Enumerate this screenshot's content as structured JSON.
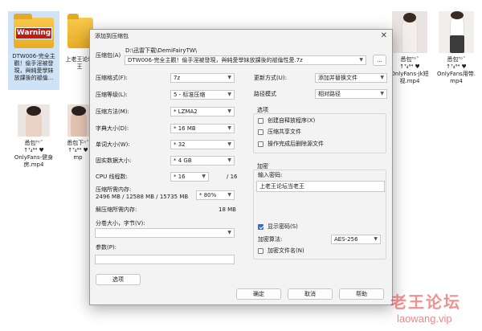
{
  "desktop": {
    "item1": {
      "badge": "Warning",
      "caption": "DTW006-完全主\n觀！偷手淫被發\n現，與純愛學妹\n放課後的褪倫..."
    },
    "item2": {
      "caption": "上老王论坛\n王"
    },
    "item3": {
      "caption": "悉包ᵀᵒ˜\n↑ᵀ₄⁶⁴ ♥\nOnlyFans-jk短\n视.mp4"
    },
    "item4": {
      "caption": "悉包ᵀᵒ˜\n↑ᵀ₄⁶⁴ ♥\nOnlyFans用带.\nmp4"
    },
    "item5": {
      "caption": "悉包ᵀᵒ˜\n↑ᵀ₄⁶⁴ ♥\nOnlyFans-健身\n房.mp4"
    },
    "item6": {
      "caption": "悉包下ᵒ˜\n↑ᵀ₄⁶⁴ ♥\nmp"
    }
  },
  "dialog": {
    "title": "添加到压缩包",
    "archive_label": "压缩包(A)",
    "archive_dir": "D:\\迅雷下载\\DemiFairyTW\\",
    "archive_name": "DTW006-完全主觀！偷手淫被發現，與純愛學妹放課後的褪倫性愛.7z",
    "browse_label": "...",
    "format_label": "压缩格式(F):",
    "format_value": "7z",
    "level_label": "压缩等级(L):",
    "level_value": "5 - 标准压缩",
    "method_label": "压缩方法(M):",
    "method_value": "* LZMA2",
    "dict_label": "字典大小(D):",
    "dict_value": "* 16 MB",
    "word_label": "单词大小(W):",
    "word_value": "* 32",
    "solid_label": "固实数据大小:",
    "solid_value": "* 4 GB",
    "threads_label": "CPU 线程数:",
    "threads_value": "* 16",
    "threads_max": "/ 16",
    "mem_label": "压缩所需内存:",
    "mem_detail": "2496 MB / 12588 MB / 15735 MB",
    "mem_percent": "* 80%",
    "decomp_label": "解压缩所需内存:",
    "decomp_value": "18 MB",
    "split_label": "分卷大小，字节(V):",
    "params_label": "参数(P):",
    "options_button": "选项",
    "update_label": "更新方式(U):",
    "update_value": "添加并替换文件",
    "path_label": "路径模式",
    "path_value": "相对路径",
    "options_group": "选项",
    "opt_sfx": "创建自释放程序(X)",
    "opt_shared": "压缩共享文件",
    "opt_delete": "操作完成后删除源文件",
    "encrypt_group": "加密",
    "password_label": "输入密码:",
    "password_value": "上老王论坛当老王",
    "show_password": "显示密码(S)",
    "enc_method_label": "加密算法:",
    "enc_method_value": "AES-256",
    "encrypt_names": "加密文件名(N)",
    "ok_button": "确定",
    "cancel_button": "取消",
    "help_button": "帮助"
  },
  "watermark": {
    "main": "老王论坛",
    "sub": "laowang.vip"
  },
  "colors": {
    "accent": "#2f6fd1",
    "warning_red": "#c21b12",
    "folder": "#f0bb3a"
  }
}
